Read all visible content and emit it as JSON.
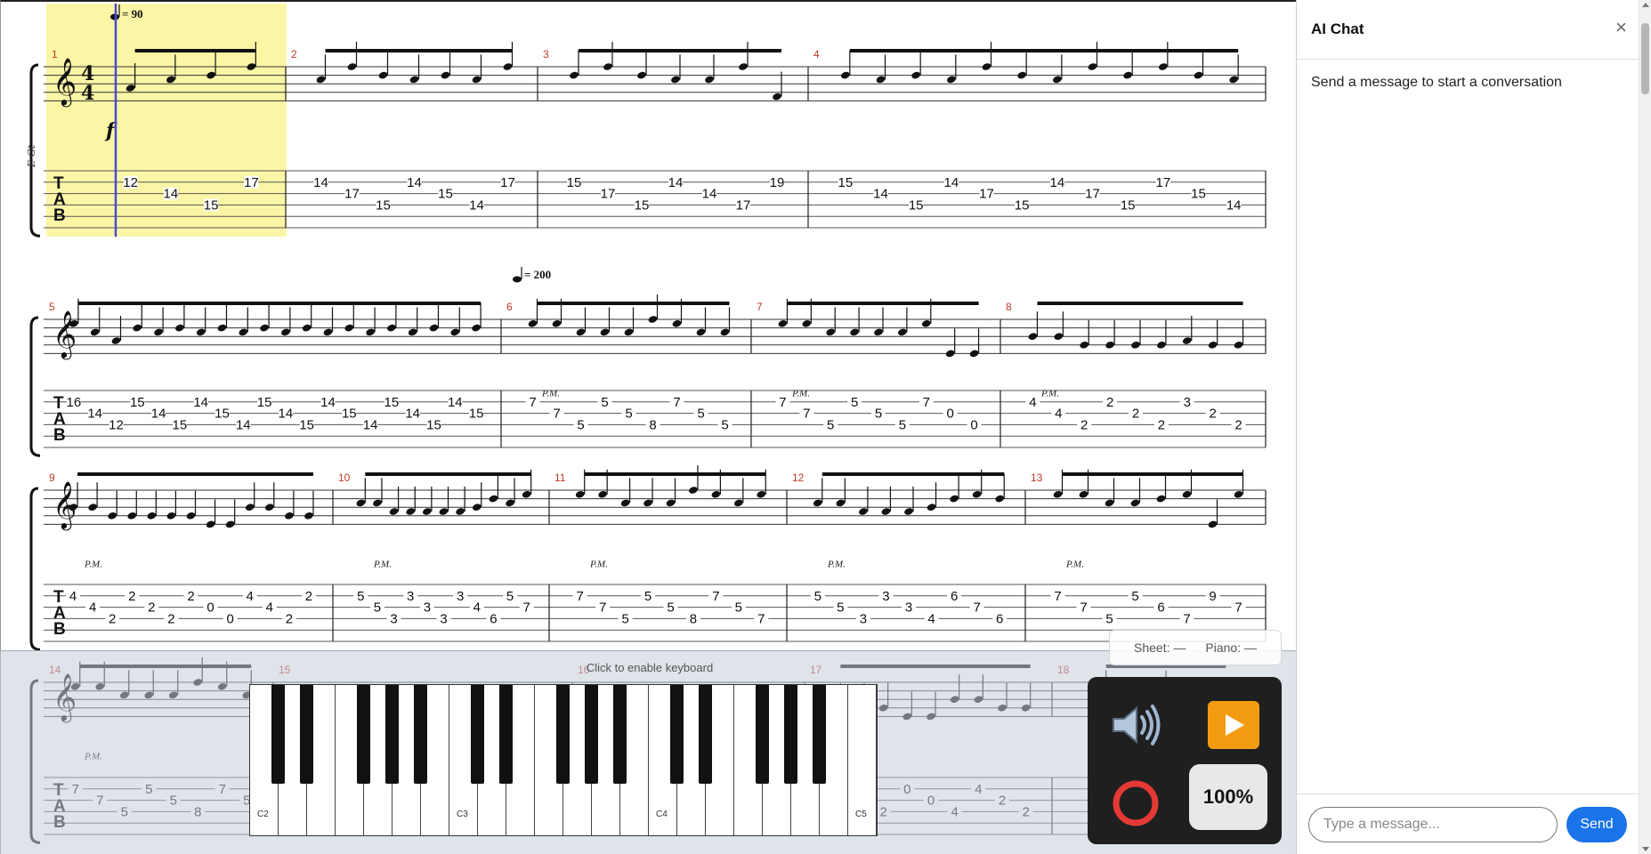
{
  "score": {
    "instrument_label": "E-Gt",
    "time_signature": {
      "top": "4",
      "bottom": "4"
    },
    "tab_clef": [
      "T",
      "A",
      "B"
    ],
    "dynamic": "f",
    "palm_mute": "P.M.",
    "tempo_markings": [
      {
        "id": "t1",
        "bpm": "= 90"
      },
      {
        "id": "t2",
        "bpm": "= 200"
      }
    ],
    "highlight_color": "#fbf6a6",
    "cursor_color": "#4a4ad0",
    "bar_number_color": "#c0392b",
    "systems": [
      {
        "id": "s1",
        "measures": [
          {
            "num": "1",
            "tab": [
              [
                "12",
                "14",
                "15",
                "17"
              ]
            ]
          },
          {
            "num": "2",
            "tab": [
              [
                "14",
                "17",
                "15",
                "14",
                "15",
                "14",
                "17"
              ]
            ]
          },
          {
            "num": "3",
            "tab": [
              [
                "15",
                "17",
                "15",
                "14",
                "14",
                "17",
                "19"
              ]
            ]
          },
          {
            "num": "4",
            "tab": [
              [
                "15",
                "14",
                "15",
                "14",
                "17",
                "15",
                "14",
                "17",
                "15",
                "17",
                "15",
                "14"
              ]
            ]
          }
        ]
      },
      {
        "id": "s2",
        "measures": [
          {
            "num": "5",
            "tab": [
              [
                "16",
                "14",
                "12",
                "15",
                "14",
                "15",
                "14",
                "15",
                "14",
                "15",
                "14",
                "15",
                "14",
                "15",
                "14",
                "15",
                "14",
                "15",
                "14",
                "15"
              ]
            ]
          },
          {
            "num": "6",
            "tab": [
              [
                "7",
                "7",
                "5",
                "5",
                "5",
                "8",
                "7",
                "5",
                "5"
              ]
            ]
          },
          {
            "num": "7",
            "tab": [
              [
                "7",
                "7",
                "5",
                "5",
                "5",
                "5",
                "7",
                "0",
                "0"
              ]
            ]
          },
          {
            "num": "8",
            "tab": [
              [
                "4",
                "4",
                "2",
                "2",
                "2",
                "2",
                "3",
                "2",
                "2"
              ]
            ]
          }
        ]
      },
      {
        "id": "s3",
        "measures": [
          {
            "num": "9",
            "tab": [
              [
                "4",
                "4",
                "2",
                "2",
                "2",
                "2",
                "2",
                "0",
                "0",
                "4",
                "4",
                "2",
                "2"
              ]
            ]
          },
          {
            "num": "10",
            "tab": [
              [
                "5",
                "5",
                "3",
                "3",
                "3",
                "3",
                "3",
                "4",
                "6",
                "5",
                "7"
              ]
            ]
          },
          {
            "num": "11",
            "tab": [
              [
                "7",
                "7",
                "5",
                "5",
                "5",
                "8",
                "7",
                "5",
                "7"
              ]
            ]
          },
          {
            "num": "12",
            "tab": [
              [
                "5",
                "5",
                "3",
                "3",
                "3",
                "4",
                "6",
                "7",
                "6"
              ]
            ]
          },
          {
            "num": "13",
            "tab": [
              [
                "7",
                "7",
                "5",
                "5",
                "6",
                "7",
                "9",
                "7"
              ]
            ]
          }
        ]
      },
      {
        "id": "s4",
        "measures": [
          {
            "num": "14",
            "tab": [
              [
                "7",
                "7",
                "5",
                "5",
                "5",
                "8",
                "7",
                "5"
              ]
            ]
          },
          {
            "num": "15",
            "tab": []
          },
          {
            "num": "16",
            "tab": []
          },
          {
            "num": "17",
            "tab": [
              [
                "2",
                "2",
                "2",
                "0",
                "0",
                "4",
                "4",
                "2",
                "2"
              ]
            ]
          },
          {
            "num": "18",
            "tab": [
              [
                "5",
                "5",
                "3"
              ]
            ]
          }
        ]
      }
    ]
  },
  "piano": {
    "hint": "Click to enable keyboard",
    "labels": [
      "C2",
      "C3",
      "C4",
      "C5"
    ]
  },
  "status": {
    "sheet_label": "Sheet:",
    "sheet_value": "—",
    "piano_label": "Piano:",
    "piano_value": "—"
  },
  "controls": {
    "volume_icon": "speaker-icon",
    "play_icon": "play-icon",
    "record_icon": "record-icon",
    "zoom": "100%",
    "play_color": "#f39c12",
    "record_color": "#e53935"
  },
  "chat": {
    "title": "AI Chat",
    "close": "×",
    "empty_message": "Send a message to start a conversation",
    "input_placeholder": "Type a message...",
    "send_label": "Send",
    "send_color": "#1a73e8"
  }
}
